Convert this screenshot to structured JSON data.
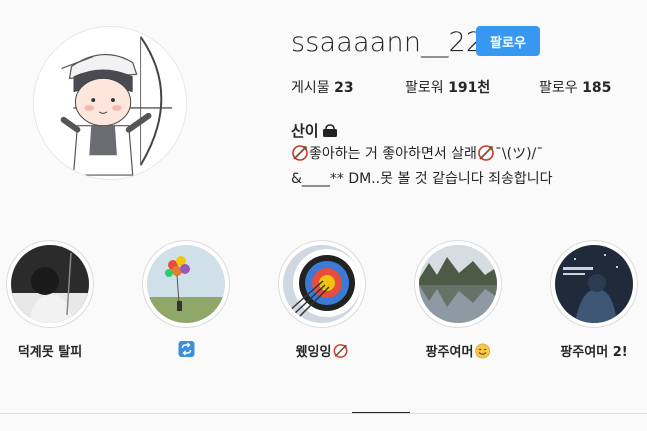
{
  "profile": {
    "username": "ssaaaann__22",
    "follow_label": "팔로우",
    "stats": {
      "posts_label": "게시물",
      "posts_value": "23",
      "followers_label": "팔로워",
      "followers_value": "191천",
      "following_label": "팔로우",
      "following_value": "185"
    },
    "bio": {
      "name": "산이",
      "line1_text": "좋아하는 거 좋아하면서 살래",
      "line1_tail": " ¯\\(ツ)/¯",
      "line2_text": "&____** DM..못 볼 것 같습니다 죄송합니다"
    }
  },
  "highlights": [
    {
      "label": "덕계못 탈피",
      "icon": null
    },
    {
      "label": "",
      "icon": "repeat-emoji"
    },
    {
      "label": "웼잉잉",
      "icon": "archery-emoji"
    },
    {
      "label": "팡주여머",
      "icon": "smile-emoji"
    },
    {
      "label": "팡주여머 2!",
      "icon": null
    }
  ],
  "colors": {
    "accent": "#3897f0",
    "text": "#262626",
    "background": "#fafafa",
    "border": "#dbdbdb"
  }
}
